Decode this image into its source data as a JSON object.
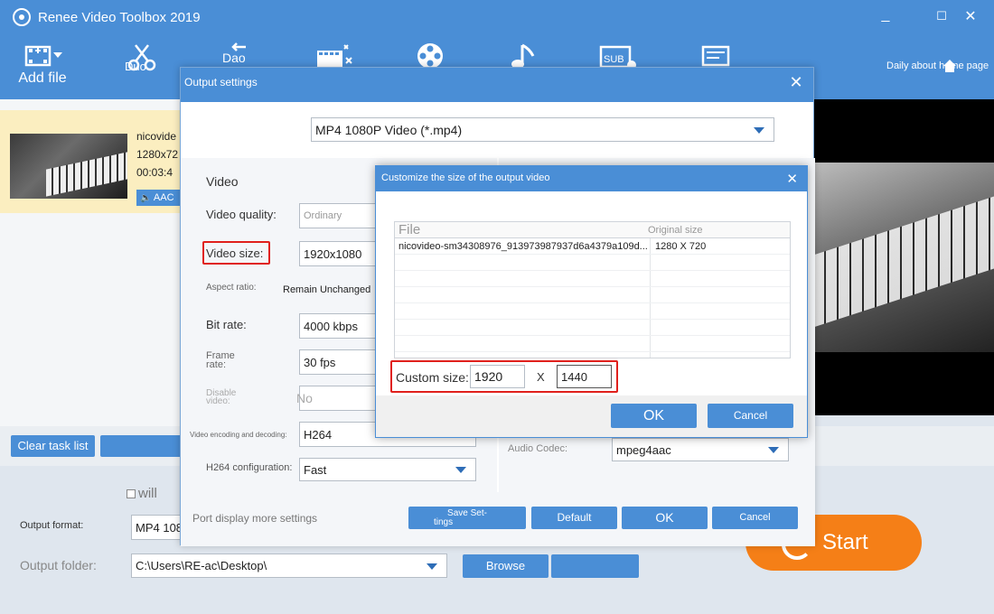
{
  "app": {
    "title": "Renee Video Toolbox 2019",
    "window_controls": {
      "minimize": "_",
      "maximize": "☐",
      "close": "✕"
    }
  },
  "toolbar": {
    "add_file": "Add file",
    "duo": "Duo",
    "dao": "Dao",
    "daily": "Daily about home page"
  },
  "file_list": {
    "items": [
      {
        "name": "nicovide",
        "resolution": "1280x72",
        "duration": "00:03:4",
        "audio": "AAC"
      }
    ]
  },
  "bottom": {
    "clear_task_list": "Clear task list",
    "checkbox_label": "will",
    "output_format_label": "Output format:",
    "output_format_value": "MP4 108",
    "output_folder_label": "Output folder:",
    "output_folder_value": "C:\\Users\\RE-ac\\Desktop\\",
    "browse": "Browse",
    "start": "Start"
  },
  "output_settings": {
    "title": "Output settings",
    "format": "MP4 1080P Video (*.mp4)",
    "video_section": "Video",
    "video_quality_label": "Video quality:",
    "video_quality_value": "Ordinary",
    "video_size_label": "Video size:",
    "video_size_value": "1920x1080",
    "aspect_ratio_label": "Aspect ratio:",
    "aspect_ratio_value": "Remain Unchanged",
    "bit_rate_label": "Bit rate:",
    "bit_rate_value": "4000 kbps",
    "frame_rate_label_1": "Frame",
    "frame_rate_label_2": "rate:",
    "frame_rate_value": "30 fps",
    "disable_video_label_1": "Disable",
    "disable_video_label_2": "video:",
    "disable_video_value": "No",
    "encoding_label": "Video encoding and decoding:",
    "encoding_value": "H264",
    "h264_config_label": "H264 configuration:",
    "h264_config_value": "Fast",
    "audio_codec_label": "Audio Codec:",
    "audio_codec_value": "mpeg4aac",
    "more_settings": "Port display more settings",
    "save_settings_1": "Save Set-",
    "save_settings_2": "tings",
    "default": "Default",
    "ok": "OK",
    "cancel": "Cancel"
  },
  "custom_size": {
    "title": "Customize the size of the output video",
    "col_file": "File",
    "col_original": "Original size",
    "rows": [
      {
        "file": "nicovideo-sm34308976_913973987937d6a4379a109d...",
        "size": "1280 X 720"
      }
    ],
    "custom_size_label": "Custom size:",
    "width": "1920",
    "x_sep": "X",
    "height": "1440",
    "ok": "OK",
    "cancel": "Cancel"
  },
  "colors": {
    "accent": "#4a8ed6",
    "start": "#f57f17",
    "highlight": "#e0201c",
    "selected_row": "#fbeec0"
  }
}
